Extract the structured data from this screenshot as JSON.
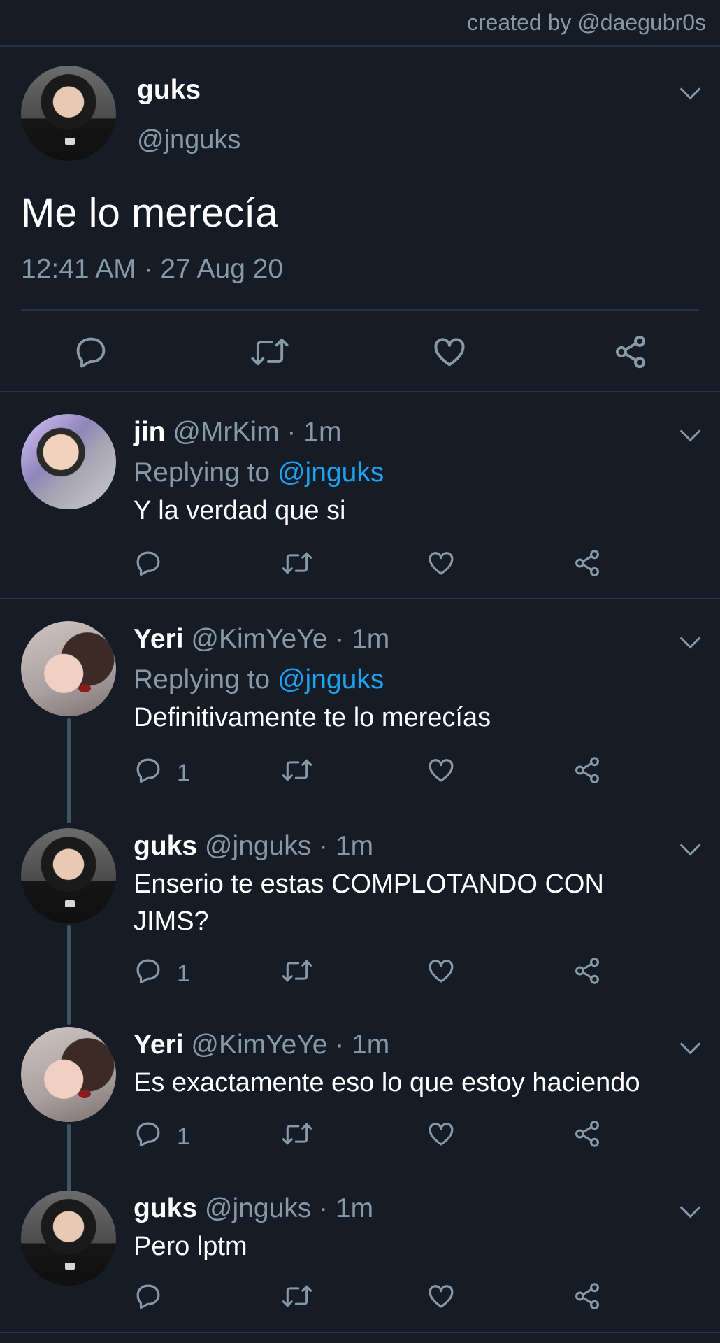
{
  "credit": "created by @daegubr0s",
  "main_tweet": {
    "name": "guks",
    "handle": "@jnguks",
    "text": "Me lo merecía",
    "timestamp": "12:41 AM · 27 Aug 20",
    "actions": [
      "reply-icon",
      "retweet-icon",
      "like-icon",
      "share-icon"
    ]
  },
  "replies": [
    {
      "name": "jin",
      "handle": "@MrKim",
      "dot": "·",
      "time": "1m",
      "replying_prefix": "Replying to",
      "replying_to": "@jnguks",
      "text": "Y la verdad que si",
      "reply_count": ""
    },
    {
      "name": "Yeri",
      "handle": "@KimYeYe",
      "dot": "·",
      "time": "1m",
      "replying_prefix": "Replying to",
      "replying_to": "@jnguks",
      "text": "Definitivamente te lo merecías",
      "reply_count": "1"
    },
    {
      "name": "guks",
      "handle": "@jnguks",
      "dot": "·",
      "time": "1m",
      "text": "Enserio te estas COMPLOTANDO CON JIMS?",
      "reply_count": "1"
    },
    {
      "name": "Yeri",
      "handle": "@KimYeYe",
      "dot": "·",
      "time": "1m",
      "text": "Es exactamente eso lo que estoy haciendo",
      "reply_count": "1"
    },
    {
      "name": "guks",
      "handle": "@jnguks",
      "dot": "·",
      "time": "1m",
      "text": "Pero lptm",
      "reply_count": ""
    }
  ],
  "colors": {
    "background": "#151c26",
    "secondary_text": "#8899a6",
    "mention": "#1da1f2",
    "divider": "#2a3440",
    "thread_line": "#3d5466"
  }
}
